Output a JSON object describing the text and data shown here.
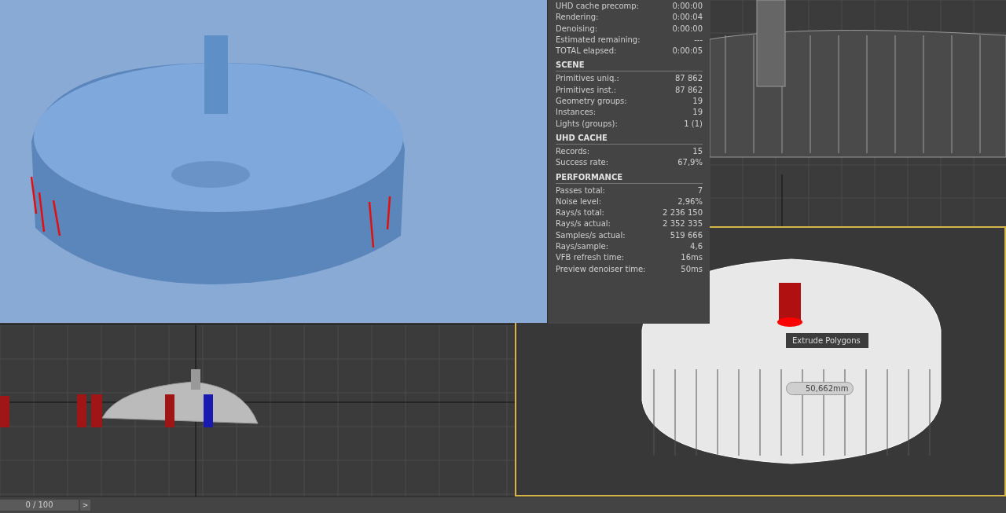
{
  "stats_panel": {
    "sections": [
      {
        "rows": [
          {
            "label": "UHD cache precomp:",
            "value": "0:00:00"
          },
          {
            "label": "Rendering:",
            "value": "0:00:04"
          },
          {
            "label": "Denoising:",
            "value": "0:00:00"
          },
          {
            "label": "Estimated remaining:",
            "value": "---"
          },
          {
            "label": "TOTAL elapsed:",
            "value": "0:00:05"
          }
        ]
      },
      {
        "title": "SCENE",
        "rows": [
          {
            "label": "Primitives uniq.:",
            "value": "87 862"
          },
          {
            "label": "Primitives inst.:",
            "value": "87 862"
          },
          {
            "label": "Geometry groups:",
            "value": "19"
          },
          {
            "label": "Instances:",
            "value": "19"
          },
          {
            "label": "Lights (groups):",
            "value": "1 (1)"
          }
        ]
      },
      {
        "title": "UHD CACHE",
        "rows": [
          {
            "label": "Records:",
            "value": "15"
          },
          {
            "label": "Success rate:",
            "value": "67,9%"
          }
        ]
      },
      {
        "title": "PERFORMANCE",
        "rows": [
          {
            "label": "Passes total:",
            "value": "7"
          },
          {
            "label": "Noise level:",
            "value": "2,96%"
          },
          {
            "label": "Rays/s total:",
            "value": "2 236 150"
          },
          {
            "label": "Rays/s actual:",
            "value": "2 352 335"
          },
          {
            "label": "Samples/s actual:",
            "value": "519 666"
          },
          {
            "label": "Rays/sample:",
            "value": "4,6"
          },
          {
            "label": "VFB refresh time:",
            "value": "16ms"
          },
          {
            "label": "Preview denoiser time:",
            "value": "50ms"
          }
        ]
      }
    ]
  },
  "perspective_viewport": {
    "active": true,
    "tooltip": "Extrude Polygons",
    "caddy_value": "50,662mm"
  },
  "timeline": {
    "frame": "0 / 100",
    "next": ">"
  }
}
